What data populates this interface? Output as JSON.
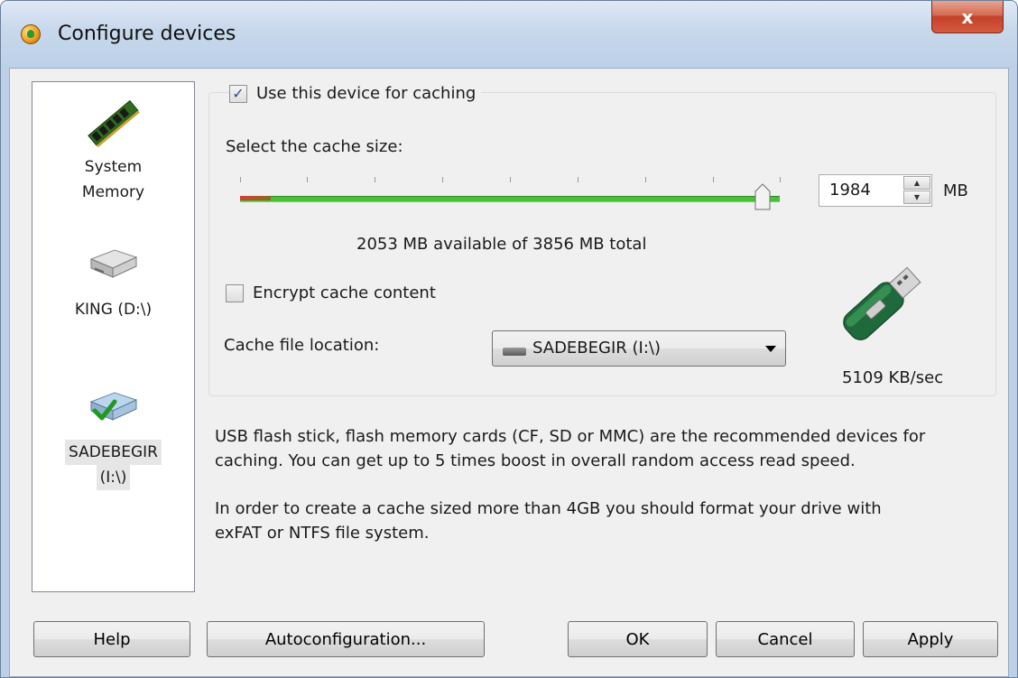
{
  "window": {
    "title": "Configure devices",
    "close_label": "x"
  },
  "devices": [
    {
      "label_line1": "System",
      "label_line2": "Memory",
      "icon": "ram-icon",
      "selected": false
    },
    {
      "label_line1": "KING (D:\\)",
      "label_line2": "",
      "icon": "hdd-icon",
      "selected": false
    },
    {
      "label_line1": "SADEBEGIR",
      "label_line2": "(I:\\)",
      "icon": "hdd-check-icon",
      "selected": true
    }
  ],
  "caching": {
    "use_device_label": "Use this device for caching",
    "use_device_checked": true,
    "cache_size_label": "Select the cache size:",
    "cache_size_value": "1984",
    "cache_size_unit": "MB",
    "slider_fraction": 0.968,
    "availability_text": "2053 MB available of 3856 MB total",
    "encrypt_label": "Encrypt cache content",
    "encrypt_checked": false,
    "location_label": "Cache file location:",
    "location_value": "SADEBEGIR (I:\\)",
    "speed_text": "5109 KB/sec"
  },
  "info": {
    "paragraph1_line1": "USB flash stick, flash memory cards (CF, SD or MMC) are the recommended devices for",
    "paragraph1_line2": "caching. You can get up to 5 times boost in overall random access read speed.",
    "paragraph2_line1": "In order to create a cache sized more than 4GB you should format your drive with",
    "paragraph2_line2": "exFAT or NTFS file system."
  },
  "buttons": {
    "help": "Help",
    "autoconfig": "Autoconfiguration...",
    "ok": "OK",
    "cancel": "Cancel",
    "apply": "Apply"
  },
  "colors": {
    "slider_green": "#4bbf3a",
    "checkmark_blue": "#2c4f8a",
    "close_red": "#c4412a"
  }
}
